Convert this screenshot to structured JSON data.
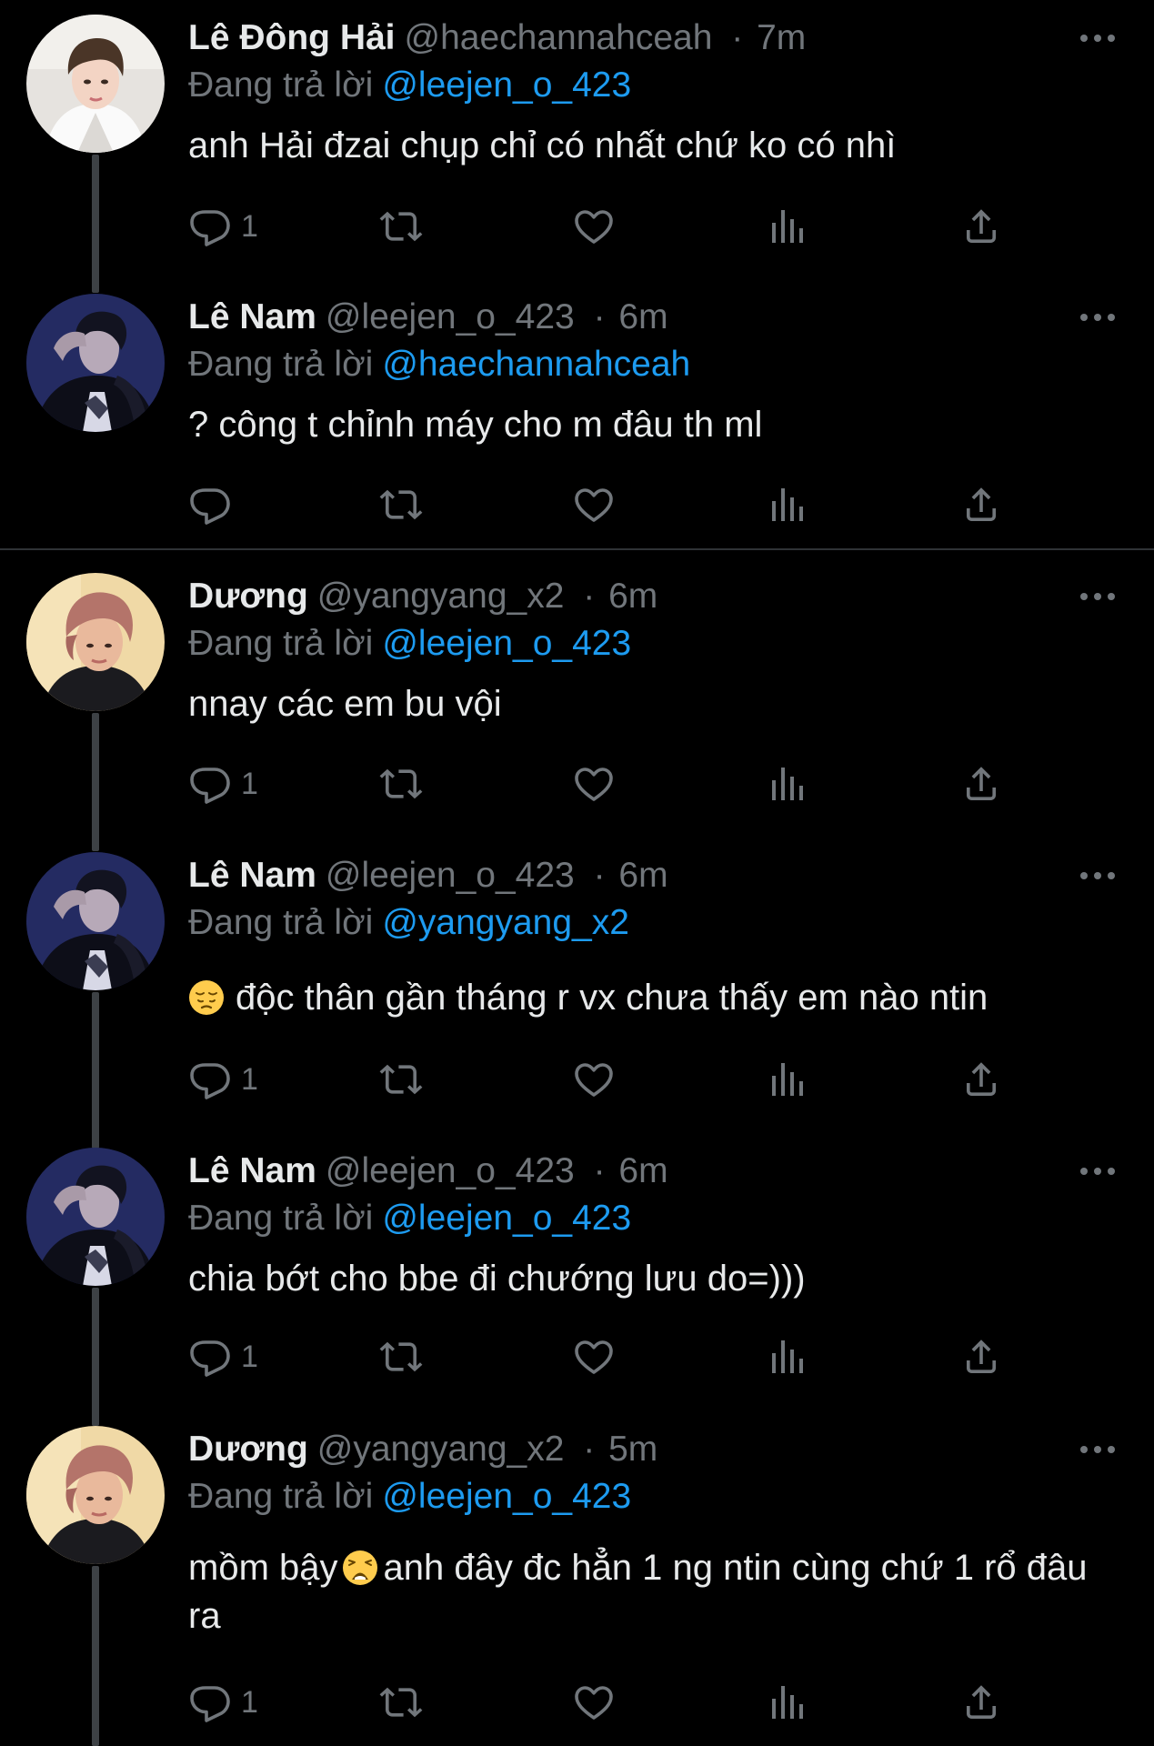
{
  "reply_prefix": "Đang trả lời",
  "tweets": [
    {
      "name": "Lê Đông Hải",
      "handle": "@haechannahceah",
      "sep": "·",
      "time": "7m",
      "reply_to": "@leejen_o_423",
      "text": "anh Hải đzai chụp chỉ có nhất chứ ko có nhì",
      "reply_count": "1"
    },
    {
      "name": "Lê Nam",
      "handle": "@leejen_o_423",
      "sep": "·",
      "time": "6m",
      "reply_to": "@haechannahceah",
      "text": "? công t chỉnh máy cho m đâu th ml",
      "reply_count": ""
    },
    {
      "name": "Dương",
      "handle": "@yangyang_x2",
      "sep": "·",
      "time": "6m",
      "reply_to": "@leejen_o_423",
      "text": "nnay các em bu vội",
      "reply_count": "1"
    },
    {
      "name": "Lê Nam",
      "handle": "@leejen_o_423",
      "sep": "·",
      "time": "6m",
      "reply_to": "@yangyang_x2",
      "emoji": "pensive-face",
      "text": "độc thân gần tháng r vx chưa thấy em nào ntin",
      "reply_count": "1"
    },
    {
      "name": "Lê Nam",
      "handle": "@leejen_o_423",
      "sep": "·",
      "time": "6m",
      "reply_to": "@leejen_o_423",
      "text": "chia bớt cho bbe đi chướng lưu do=)))",
      "reply_count": "1"
    },
    {
      "name": "Dương",
      "handle": "@yangyang_x2",
      "sep": "·",
      "time": "5m",
      "reply_to": "@leejen_o_423",
      "text_before": "mồm bậy",
      "emoji": "weary-face",
      "text_after": "anh đây đc hẳn 1 ng ntin cùng chứ 1 rổ đâu ra",
      "reply_count": "1"
    }
  ],
  "colors": {
    "background": "#000000",
    "text": "#e7e9ea",
    "muted": "#71767b",
    "link": "#1d9bf0",
    "divider": "#2f3336",
    "thread_line": "#3d4145"
  }
}
